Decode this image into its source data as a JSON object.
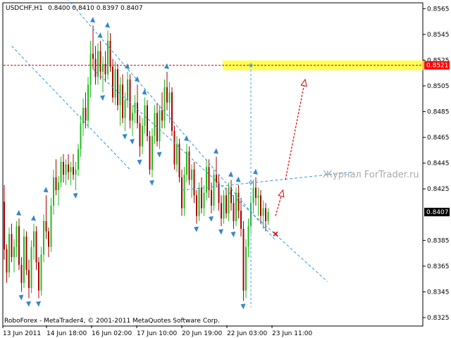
{
  "header": {
    "symbol": "USDCHF,H1",
    "ohlc": "0.8400 0.8410 0.8397 0.8407"
  },
  "footer": {
    "copyright": "RoboForex - MetaTrader4, © 2001-2011 MetaQuotes Software Corp."
  },
  "watermark": "Журнал ForTrader.ru",
  "colors": {
    "up_candle": "#22bb22",
    "down_candle": "#aa0000",
    "channel": "#3399dd",
    "target": "#dd0000",
    "highlight": "#ffff55",
    "fractal": "#3388cc",
    "price_tag_bg": "#ff0000",
    "current_tag_bg": "#000000"
  },
  "chart_data": {
    "type": "candlestick",
    "ylim": [
      0.8319,
      0.8569
    ],
    "yticks": [
      "0.8565",
      "0.8545",
      "0.8525",
      "0.8505",
      "0.8485",
      "0.8465",
      "0.8445",
      "0.8425",
      "0.8385",
      "0.8365",
      "0.8345",
      "0.8325"
    ],
    "xticks": [
      "13 Jun 2011",
      "14 Jun 18:00",
      "16 Jun 02:00",
      "17 Jun 10:00",
      "20 Jun 19:00",
      "22 Jun 03:00",
      "23 Jun 11:00"
    ],
    "levels": [
      {
        "value": 0.8521,
        "label": "0.8521",
        "type": "target"
      },
      {
        "value": 0.8407,
        "label": "0.8407",
        "type": "current"
      }
    ],
    "candles": [
      [
        0.8415,
        0.8428,
        0.837,
        0.8378
      ],
      [
        0.8378,
        0.8382,
        0.8352,
        0.836
      ],
      [
        0.836,
        0.8395,
        0.8356,
        0.839
      ],
      [
        0.839,
        0.8398,
        0.8368,
        0.8372
      ],
      [
        0.8372,
        0.8386,
        0.836,
        0.838
      ],
      [
        0.838,
        0.84,
        0.8372,
        0.8396
      ],
      [
        0.8396,
        0.8402,
        0.8362,
        0.8366
      ],
      [
        0.8366,
        0.8372,
        0.8345,
        0.8352
      ],
      [
        0.8352,
        0.8394,
        0.8348,
        0.8388
      ],
      [
        0.8388,
        0.8392,
        0.8358,
        0.8362
      ],
      [
        0.8362,
        0.837,
        0.834,
        0.8348
      ],
      [
        0.8348,
        0.8385,
        0.8344,
        0.838
      ],
      [
        0.838,
        0.8398,
        0.837,
        0.8392
      ],
      [
        0.8392,
        0.8396,
        0.8362,
        0.8368
      ],
      [
        0.8368,
        0.8372,
        0.834,
        0.8346
      ],
      [
        0.8346,
        0.838,
        0.8342,
        0.8374
      ],
      [
        0.8374,
        0.8405,
        0.8368,
        0.84
      ],
      [
        0.84,
        0.842,
        0.8386,
        0.8392
      ],
      [
        0.8392,
        0.8395,
        0.8372,
        0.838
      ],
      [
        0.838,
        0.8418,
        0.8376,
        0.8412
      ],
      [
        0.8412,
        0.844,
        0.8405,
        0.8434
      ],
      [
        0.8434,
        0.8448,
        0.842,
        0.8424
      ],
      [
        0.8424,
        0.8435,
        0.8412,
        0.843
      ],
      [
        0.843,
        0.845,
        0.8426,
        0.8446
      ],
      [
        0.8446,
        0.8452,
        0.843,
        0.8436
      ],
      [
        0.8436,
        0.8448,
        0.8428,
        0.8444
      ],
      [
        0.8444,
        0.8452,
        0.8432,
        0.8438
      ],
      [
        0.8438,
        0.8446,
        0.8428,
        0.8442
      ],
      [
        0.8442,
        0.8452,
        0.8432,
        0.8436
      ],
      [
        0.8436,
        0.8446,
        0.8424,
        0.844
      ],
      [
        0.844,
        0.846,
        0.8435,
        0.8456
      ],
      [
        0.8456,
        0.8482,
        0.845,
        0.8476
      ],
      [
        0.8476,
        0.8495,
        0.8466,
        0.8488
      ],
      [
        0.8488,
        0.85,
        0.8472,
        0.8478
      ],
      [
        0.8478,
        0.8512,
        0.8472,
        0.8506
      ],
      [
        0.8506,
        0.854,
        0.8496,
        0.853
      ],
      [
        0.853,
        0.8552,
        0.8518,
        0.8526
      ],
      [
        0.8526,
        0.8536,
        0.8506,
        0.8512
      ],
      [
        0.8512,
        0.8538,
        0.8506,
        0.8532
      ],
      [
        0.8532,
        0.854,
        0.851,
        0.8516
      ],
      [
        0.8516,
        0.8528,
        0.85,
        0.8522
      ],
      [
        0.8522,
        0.8532,
        0.8508,
        0.8514
      ],
      [
        0.8514,
        0.8548,
        0.851,
        0.854
      ],
      [
        0.854,
        0.8546,
        0.8516,
        0.852
      ],
      [
        0.852,
        0.8526,
        0.8492,
        0.8496
      ],
      [
        0.8496,
        0.8524,
        0.849,
        0.8518
      ],
      [
        0.8518,
        0.8522,
        0.8486,
        0.849
      ],
      [
        0.849,
        0.8512,
        0.8474,
        0.8506
      ],
      [
        0.8506,
        0.8514,
        0.8476,
        0.848
      ],
      [
        0.848,
        0.85,
        0.847,
        0.8494
      ],
      [
        0.8494,
        0.8516,
        0.8488,
        0.851
      ],
      [
        0.851,
        0.8514,
        0.8472,
        0.8478
      ],
      [
        0.8478,
        0.849,
        0.8466,
        0.8484
      ],
      [
        0.8484,
        0.8498,
        0.8476,
        0.8492
      ],
      [
        0.8492,
        0.8506,
        0.8472,
        0.8476
      ],
      [
        0.8476,
        0.8482,
        0.845,
        0.8458
      ],
      [
        0.8458,
        0.848,
        0.8452,
        0.8474
      ],
      [
        0.8474,
        0.8496,
        0.8468,
        0.849
      ],
      [
        0.849,
        0.8494,
        0.8462,
        0.8466
      ],
      [
        0.8466,
        0.847,
        0.8436,
        0.844
      ],
      [
        0.844,
        0.8472,
        0.8434,
        0.8466
      ],
      [
        0.8466,
        0.849,
        0.846,
        0.8484
      ],
      [
        0.8484,
        0.8492,
        0.8458,
        0.8462
      ],
      [
        0.8462,
        0.849,
        0.8456,
        0.8486
      ],
      [
        0.8486,
        0.85,
        0.8472,
        0.8478
      ],
      [
        0.8478,
        0.851,
        0.8472,
        0.8504
      ],
      [
        0.8504,
        0.8516,
        0.8486,
        0.8492
      ],
      [
        0.8492,
        0.8508,
        0.8476,
        0.85
      ],
      [
        0.85,
        0.8504,
        0.8466,
        0.847
      ],
      [
        0.847,
        0.8474,
        0.844,
        0.8444
      ],
      [
        0.8444,
        0.8466,
        0.8438,
        0.846
      ],
      [
        0.846,
        0.8464,
        0.843,
        0.8434
      ],
      [
        0.8434,
        0.844,
        0.8404,
        0.841
      ],
      [
        0.841,
        0.8442,
        0.8404,
        0.8436
      ],
      [
        0.8436,
        0.846,
        0.843,
        0.8454
      ],
      [
        0.8454,
        0.8458,
        0.8428,
        0.8432
      ],
      [
        0.8432,
        0.8444,
        0.8418,
        0.844
      ],
      [
        0.844,
        0.8446,
        0.8414,
        0.842
      ],
      [
        0.842,
        0.8424,
        0.8398,
        0.8404
      ],
      [
        0.8404,
        0.843,
        0.84,
        0.8426
      ],
      [
        0.8426,
        0.8434,
        0.8406,
        0.841
      ],
      [
        0.841,
        0.8428,
        0.8404,
        0.8422
      ],
      [
        0.8422,
        0.8448,
        0.8416,
        0.8442
      ],
      [
        0.8442,
        0.8448,
        0.8418,
        0.8424
      ],
      [
        0.8424,
        0.843,
        0.8406,
        0.8412
      ],
      [
        0.8412,
        0.844,
        0.8408,
        0.8436
      ],
      [
        0.8436,
        0.845,
        0.8426,
        0.843
      ],
      [
        0.843,
        0.8436,
        0.8408,
        0.8414
      ],
      [
        0.8414,
        0.842,
        0.8396,
        0.8402
      ],
      [
        0.8402,
        0.8424,
        0.8398,
        0.842
      ],
      [
        0.842,
        0.8426,
        0.8402,
        0.8406
      ],
      [
        0.8406,
        0.843,
        0.84,
        0.8426
      ],
      [
        0.8426,
        0.8432,
        0.8408,
        0.8414
      ],
      [
        0.8414,
        0.842,
        0.8394,
        0.84
      ],
      [
        0.84,
        0.8426,
        0.8396,
        0.8422
      ],
      [
        0.8422,
        0.8428,
        0.8402,
        0.8408
      ],
      [
        0.8408,
        0.8418,
        0.8388,
        0.8394
      ],
      [
        0.8394,
        0.84,
        0.8338,
        0.8346
      ],
      [
        0.8346,
        0.8386,
        0.834,
        0.838
      ],
      [
        0.838,
        0.8402,
        0.8372,
        0.8396
      ],
      [
        0.8396,
        0.842,
        0.839,
        0.8414
      ],
      [
        0.8414,
        0.8432,
        0.8406,
        0.8426
      ],
      [
        0.8426,
        0.8434,
        0.8412,
        0.8418
      ],
      [
        0.8418,
        0.8426,
        0.8404,
        0.842
      ],
      [
        0.842,
        0.8424,
        0.8398,
        0.8404
      ],
      [
        0.8404,
        0.8416,
        0.8394,
        0.841
      ],
      [
        0.841,
        0.8414,
        0.8392,
        0.84
      ],
      [
        0.84,
        0.841,
        0.8397,
        0.8407
      ]
    ],
    "channel_lines": [
      {
        "from": [
          3,
          0.8536
        ],
        "to": [
          51,
          0.844
        ]
      },
      {
        "from": [
          24,
          0.8576
        ],
        "to": [
          110,
          0.8385
        ]
      },
      {
        "from": [
          36,
          0.8518
        ],
        "to": [
          131,
          0.8353
        ]
      }
    ],
    "neckline": {
      "from": [
        72,
        0.8424
      ],
      "to": [
        141,
        0.8438
      ]
    },
    "vertical_line": {
      "x": 100,
      "from": 0.8521,
      "to": 0.8333
    },
    "target_arrows": [
      {
        "from": [
          110,
          0.8404
        ],
        "to": [
          113,
          0.8424
        ]
      },
      {
        "from": [
          114,
          0.8432
        ],
        "to": [
          122,
          0.851
        ]
      }
    ],
    "stop_mark": {
      "x": 110,
      "y": 0.839
    }
  }
}
